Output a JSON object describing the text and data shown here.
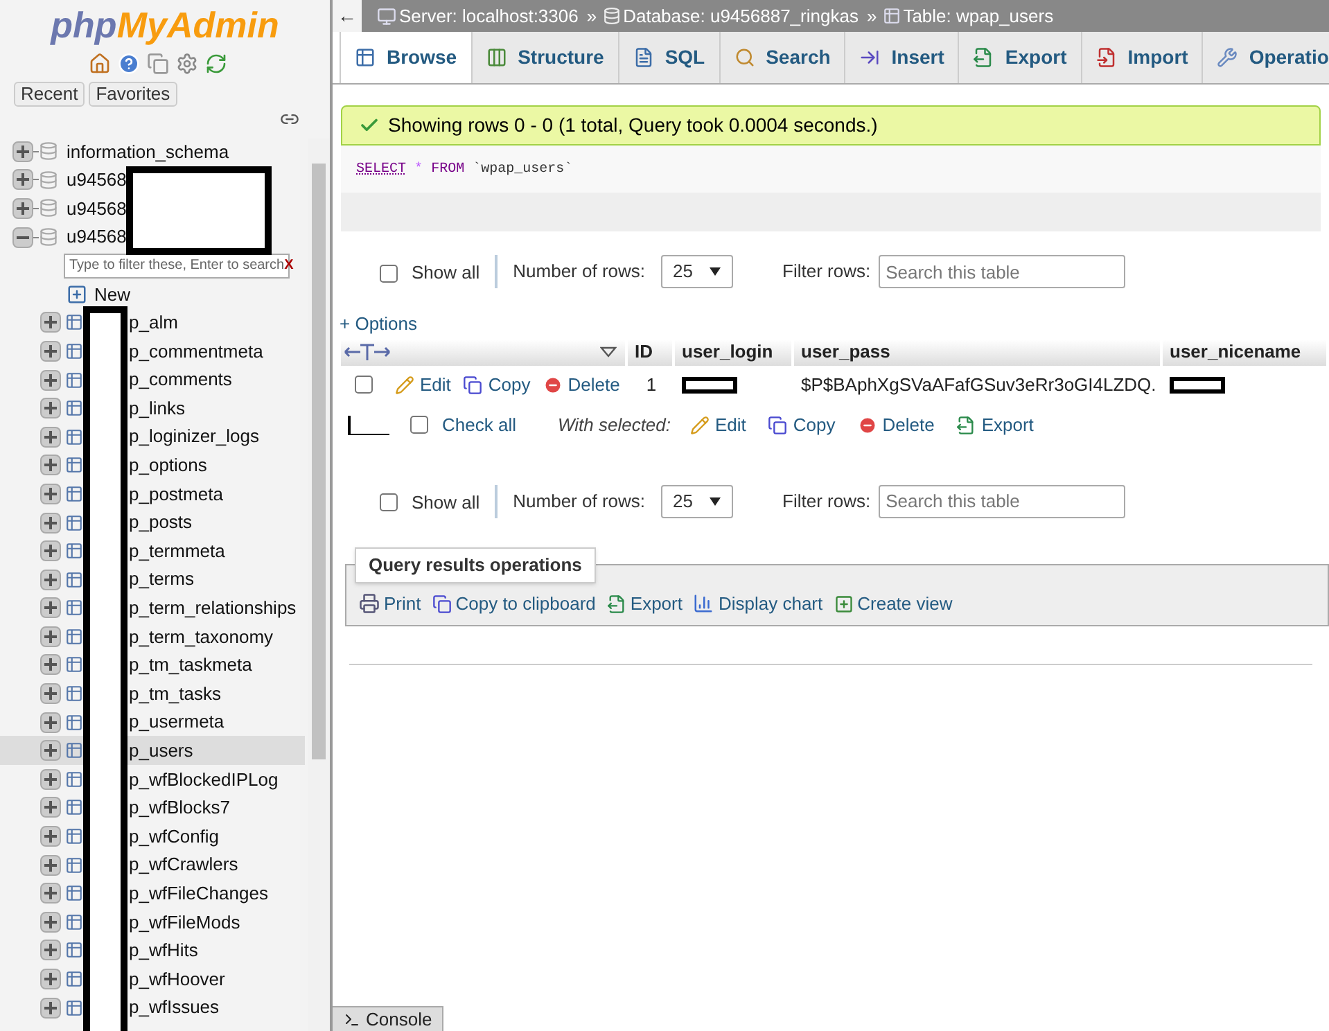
{
  "sidebar": {
    "logo_left": "php",
    "logo_right": "MyAdmin",
    "buttons": [
      "Recent",
      "Favorites"
    ],
    "databases": [
      {
        "name": "information_schema",
        "expanded": false
      },
      {
        "name": "u94568",
        "expanded": false
      },
      {
        "name": "u94568",
        "expanded": false
      },
      {
        "name": "u94568",
        "expanded": true,
        "filter_placeholder": "Type to filter these, Enter to search",
        "filter_clear": "X",
        "new": "New",
        "tables": [
          {
            "name": "p_alm",
            "selected": false
          },
          {
            "name": "p_commentmeta",
            "selected": false
          },
          {
            "name": "p_comments",
            "selected": false
          },
          {
            "name": "p_links",
            "selected": false
          },
          {
            "name": "p_loginizer_logs",
            "selected": false
          },
          {
            "name": "p_options",
            "selected": false
          },
          {
            "name": "p_postmeta",
            "selected": false
          },
          {
            "name": "p_posts",
            "selected": false
          },
          {
            "name": "p_termmeta",
            "selected": false
          },
          {
            "name": "p_terms",
            "selected": false
          },
          {
            "name": "p_term_relationships",
            "selected": false
          },
          {
            "name": "p_term_taxonomy",
            "selected": false
          },
          {
            "name": "p_tm_taskmeta",
            "selected": false
          },
          {
            "name": "p_tm_tasks",
            "selected": false
          },
          {
            "name": "p_usermeta",
            "selected": false
          },
          {
            "name": "p_users",
            "selected": true
          },
          {
            "name": "p_wfBlockedIPLog",
            "selected": false
          },
          {
            "name": "p_wfBlocks7",
            "selected": false
          },
          {
            "name": "p_wfConfig",
            "selected": false
          },
          {
            "name": "p_wfCrawlers",
            "selected": false
          },
          {
            "name": "p_wfFileChanges",
            "selected": false
          },
          {
            "name": "p_wfFileMods",
            "selected": false
          },
          {
            "name": "p_wfHits",
            "selected": false
          },
          {
            "name": "p_wfHoover",
            "selected": false
          },
          {
            "name": "p_wfIssues",
            "selected": false
          }
        ]
      }
    ]
  },
  "back": "←",
  "breadcrumb": [
    {
      "kind": "server",
      "label": "Server: localhost:3306"
    },
    {
      "kind": "database",
      "label": "Database: u9456887_ringkas"
    },
    {
      "kind": "table",
      "label": "Table: wpap_users"
    }
  ],
  "breadcrumb_separator": "»",
  "tabs": [
    {
      "kind": "browse",
      "label": "Browse",
      "selected": true
    },
    {
      "kind": "structure",
      "label": "Structure",
      "selected": false
    },
    {
      "kind": "sql",
      "label": "SQL",
      "selected": false
    },
    {
      "kind": "search",
      "label": "Search",
      "selected": false
    },
    {
      "kind": "insert",
      "label": "Insert",
      "selected": false
    },
    {
      "kind": "export",
      "label": "Export",
      "selected": false
    },
    {
      "kind": "import",
      "label": "Import",
      "selected": false
    },
    {
      "kind": "operations",
      "label": "Operatio",
      "selected": false
    }
  ],
  "message": "Showing rows 0 - 0 (1 total, Query took 0.0004 seconds.)",
  "sql": {
    "select": "SELECT",
    "star": "*",
    "from": "FROM",
    "table": "`wpap_users`"
  },
  "nav_top": {
    "show_all": "Show all",
    "show_all_checked": false,
    "rows_label": "Number of rows:",
    "rows_value": "25",
    "filter_label": "Filter rows:",
    "filter_placeholder": "Search this table"
  },
  "options": "+ Options",
  "table": {
    "columns": [
      "ID",
      "user_login",
      "user_pass",
      "user_nicename"
    ],
    "rows": [
      {
        "checked": false,
        "actions": [
          "Edit",
          "Copy",
          "Delete"
        ],
        "cells": [
          {
            "kind": "text",
            "text": "1"
          },
          {
            "kind": "redacted"
          },
          {
            "kind": "text",
            "text": "$P$BAphXgSVaAFafGSuv3eRr3oGI4LZDQ."
          },
          {
            "kind": "redacted"
          }
        ]
      }
    ]
  },
  "with_selected": {
    "check_all": "Check all",
    "checked": false,
    "label": "With selected:",
    "actions": [
      "Edit",
      "Copy",
      "Delete",
      "Export"
    ]
  },
  "nav_bottom": {
    "show_all": "Show all",
    "show_all_checked": false,
    "rows_label": "Number of rows:",
    "rows_value": "25",
    "filter_label": "Filter rows:",
    "filter_placeholder": "Search this table"
  },
  "query_ops": {
    "title": "Query results operations",
    "actions": [
      "Print",
      "Copy to clipboard",
      "Export",
      "Display chart",
      "Create view"
    ]
  },
  "console": "Console"
}
